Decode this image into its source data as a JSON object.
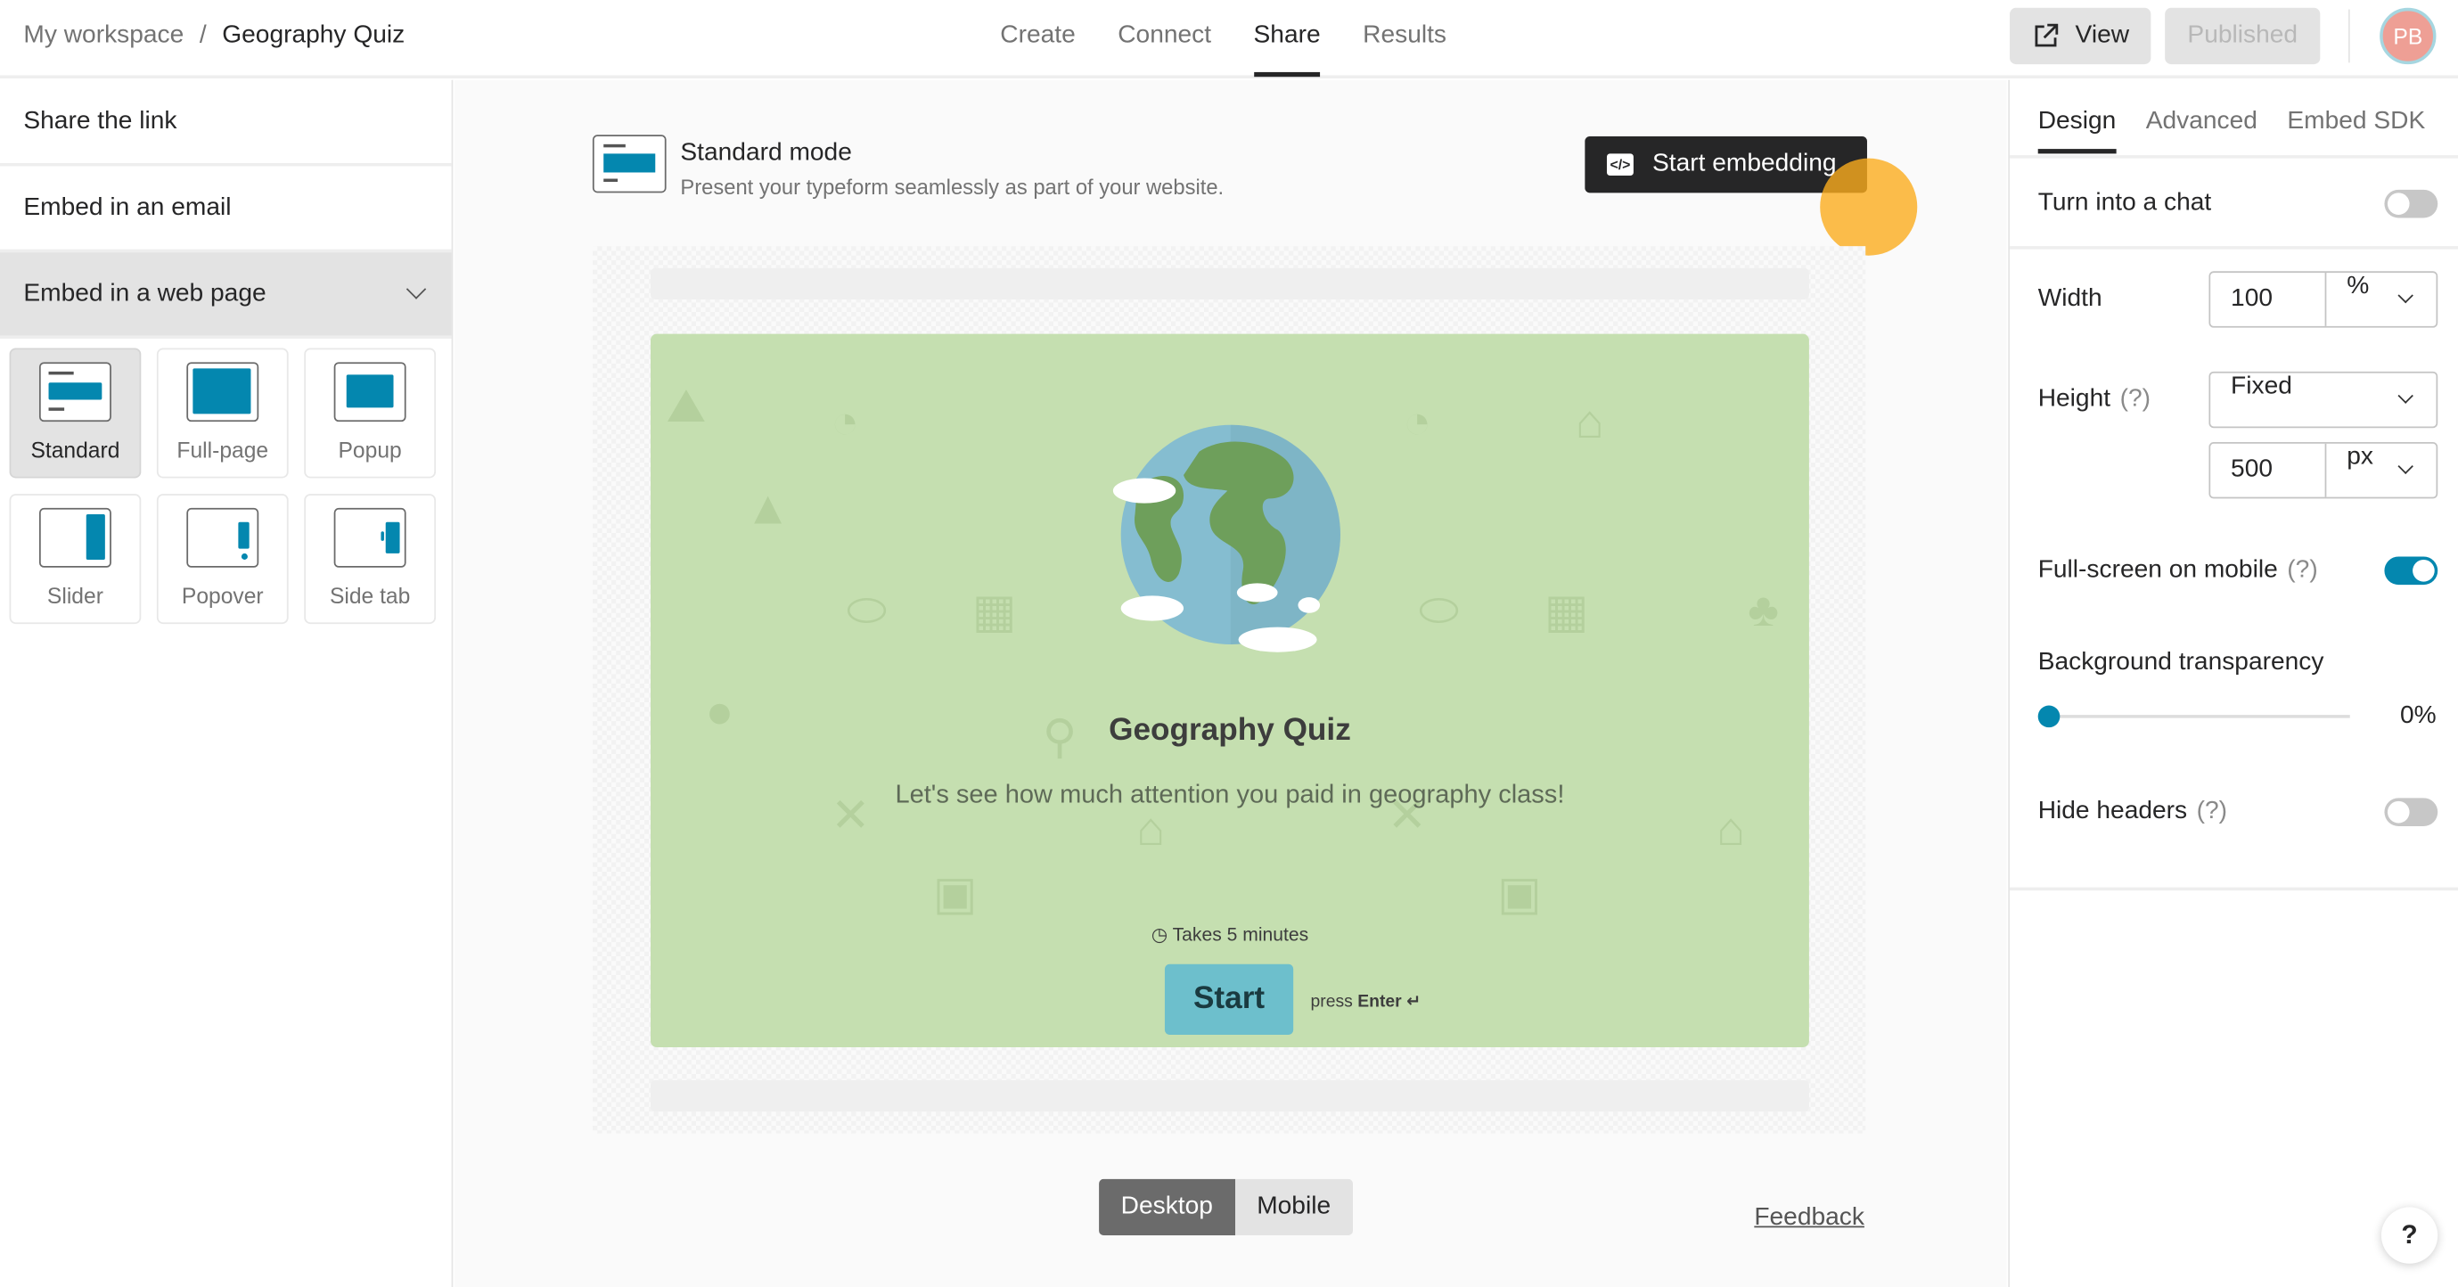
{
  "header": {
    "workspace": "My workspace",
    "separator": "/",
    "form_title": "Geography Quiz",
    "nav": [
      "Create",
      "Connect",
      "Share",
      "Results"
    ],
    "active_nav": "Share",
    "view_label": "View",
    "published_label": "Published",
    "avatar_initials": "PB"
  },
  "sidebar": {
    "items": [
      "Share the link",
      "Embed in an email",
      "Embed in a web page"
    ],
    "modes": [
      "Standard",
      "Full-page",
      "Popup",
      "Slider",
      "Popover",
      "Side tab"
    ],
    "selected_mode": "Standard"
  },
  "main": {
    "mode_title": "Standard mode",
    "mode_desc": "Present your typeform seamlessly as part of your website.",
    "start_label": "Start embedding",
    "preview": {
      "title": "Geography Quiz",
      "subtitle": "Let's see how much attention you paid in geography class!",
      "time": "Takes 5 minutes",
      "start": "Start",
      "press": "press",
      "enter": "Enter ↵"
    },
    "device_tabs": [
      "Desktop",
      "Mobile"
    ],
    "active_device": "Desktop",
    "feedback": "Feedback"
  },
  "panel": {
    "tabs": [
      "Design",
      "Advanced",
      "Embed SDK"
    ],
    "active_tab": "Design",
    "chat_label": "Turn into a chat",
    "chat_on": false,
    "width_label": "Width",
    "width_value": "100",
    "width_unit": "%",
    "height_label": "Height",
    "help": "(?)",
    "height_mode": "Fixed",
    "height_value": "500",
    "height_unit": "px",
    "fullscreen_label": "Full-screen on mobile",
    "fullscreen_on": true,
    "transparency_label": "Background transparency",
    "transparency_value": "0%",
    "hide_headers_label": "Hide headers",
    "hide_headers_on": false,
    "help_button": "?"
  },
  "colors": {
    "accent": "#0487af",
    "preview_bg": "#c5dfb0",
    "start_button": "#6dbfcc",
    "cursor_dot": "#fbb42b"
  }
}
